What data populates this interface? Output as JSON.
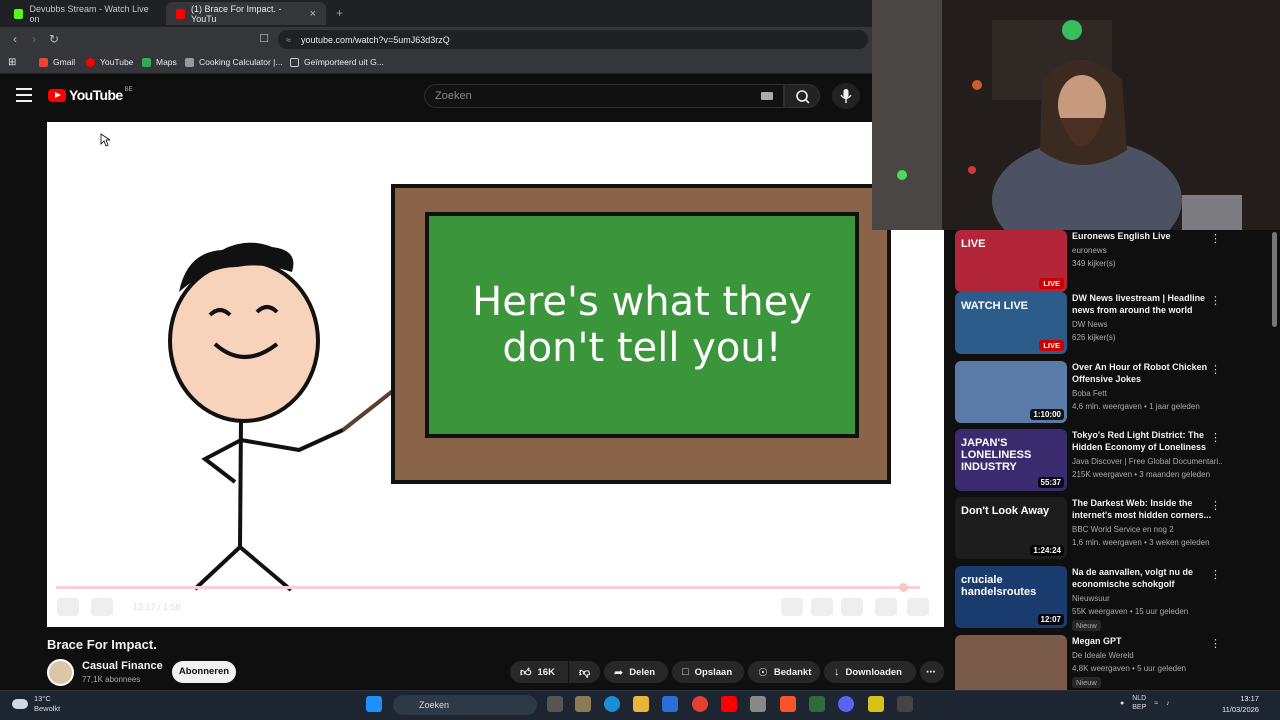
{
  "browser": {
    "tabs": [
      {
        "label": "Devubbs Stream - Watch Live on",
        "active": false
      },
      {
        "label": "(1) Brace For Impact. - YouTu",
        "active": true
      }
    ],
    "url": "youtube.com/watch?v=5umJ63d3rzQ",
    "bookmarks": [
      "Gmail",
      "YouTube",
      "Maps",
      "Cooking Calculator |...",
      "Geïmporteerd uit G..."
    ]
  },
  "youtube": {
    "logo_text": "YouTube",
    "logo_country": "BE",
    "search_placeholder": "Zoeken"
  },
  "player": {
    "board_text": "Here's what they don't tell you!",
    "time_display": "12:17 / 1:58",
    "progress": 0.98
  },
  "video": {
    "title": "Brace For Impact.",
    "channel": "Casual Finance",
    "subscribers": "77,1K abonnees",
    "subscribe_label": "Abonneren",
    "likes": "16K",
    "share_label": "Delen",
    "save_label": "Opslaan",
    "thanks_label": "Bedankt",
    "download_label": "Downloaden"
  },
  "sidebar": [
    {
      "title": "Euronews English Live",
      "channel": "euronews",
      "meta": "349 kijker(s)",
      "badge": "LIVE",
      "thumb_color": "#b3263a",
      "thumb_text": "LIVE"
    },
    {
      "title": "DW News livestream | Headline news from around the world",
      "channel": "DW News",
      "meta": "626 kijker(s)",
      "badge": "LIVE",
      "thumb_color": "#2b5c8a",
      "thumb_text": "WATCH LIVE"
    },
    {
      "title": "Over An Hour of Robot Chicken Offensive Jokes",
      "channel": "Boba Fett",
      "meta": "4,6 mln. weergaven • 1 jaar geleden",
      "badge": "1:10:00",
      "thumb_color": "#5a7aa8",
      "thumb_text": ""
    },
    {
      "title": "Tokyo's Red Light District: The Hidden Economy of Loneliness",
      "channel": "Java Discover | Free Global Documentari...",
      "meta": "215K weergaven • 3 maanden geleden",
      "badge": "55:37",
      "thumb_color": "#3a2a6e",
      "thumb_text": "JAPAN'S LONELINESS INDUSTRY"
    },
    {
      "title": "The Darkest Web: Inside the internet's most hidden corners...",
      "channel": "BBC World Service en nog 2",
      "meta": "1,6 mln. weergaven • 3 weken geleden",
      "badge": "1:24:24",
      "thumb_color": "#1d1d1d",
      "thumb_text": "Don't Look Away"
    },
    {
      "title": "Na de aanvallen, volgt nu de economische schokgolf",
      "channel": "Nieuwsuur",
      "meta": "55K weergaven • 15 uur geleden",
      "badge": "12:07",
      "thumb_color": "#1a3b6e",
      "thumb_text": "cruciale handelsroutes",
      "new": "Nieuw"
    },
    {
      "title": "Megan GPT",
      "channel": "De Ideale Wereld",
      "meta": "4,8K weergaven • 5 uur geleden",
      "badge": "",
      "thumb_color": "#7a5a48",
      "thumb_text": "",
      "new": "Nieuw"
    }
  ],
  "taskbar": {
    "temp": "13°C",
    "weather": "Bewolkt",
    "search": "Zoeken",
    "lang1": "NLD",
    "lang2": "BEP",
    "time": "13:17",
    "date": "11/03/2026"
  },
  "colors": {
    "yt_red": "#ff0000",
    "board_green": "#3b963b",
    "board_frame": "#8a6448"
  }
}
